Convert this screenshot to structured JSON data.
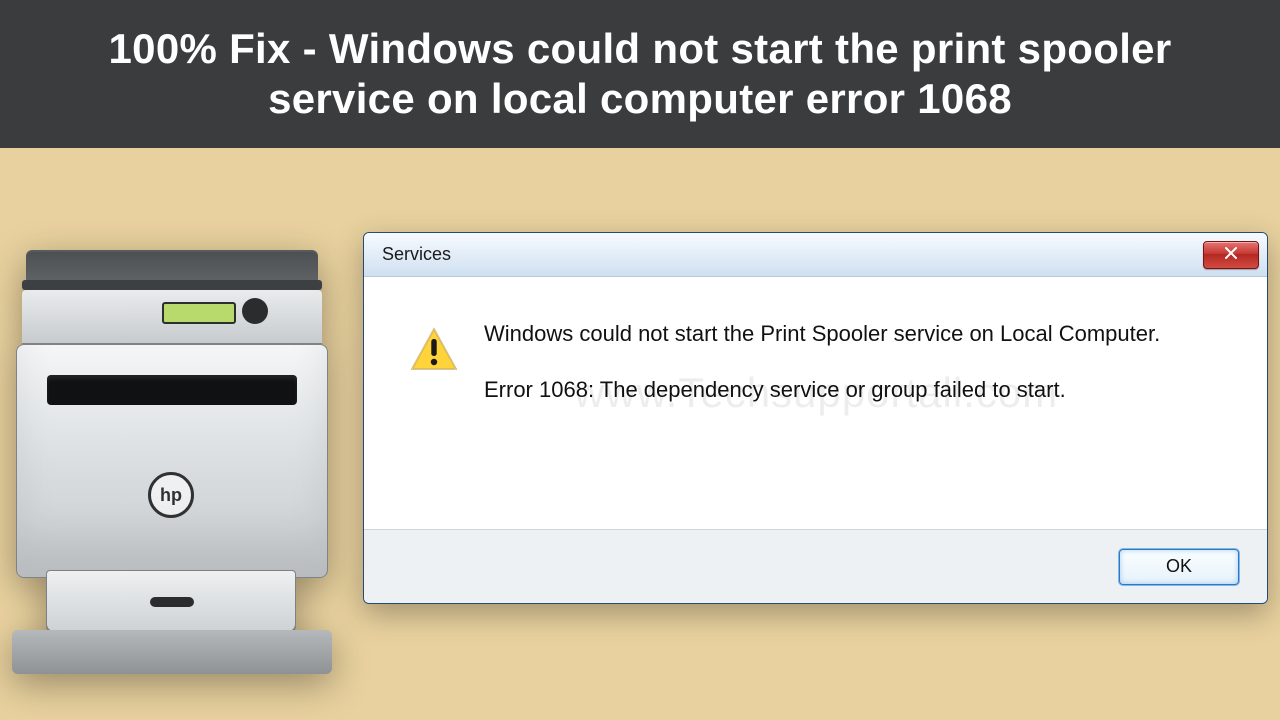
{
  "hero": {
    "headline": "100% Fix - Windows could not start the print spooler service on local computer error 1068"
  },
  "printer": {
    "brand": "hp"
  },
  "dialog": {
    "title": "Services",
    "close_label": "X",
    "message_line1": "Windows could not start the Print Spooler service on Local Computer.",
    "message_line2": "Error 1068: The dependency service or group failed to start.",
    "watermark": "www.Techsupportall.com",
    "ok_label": "OK"
  }
}
